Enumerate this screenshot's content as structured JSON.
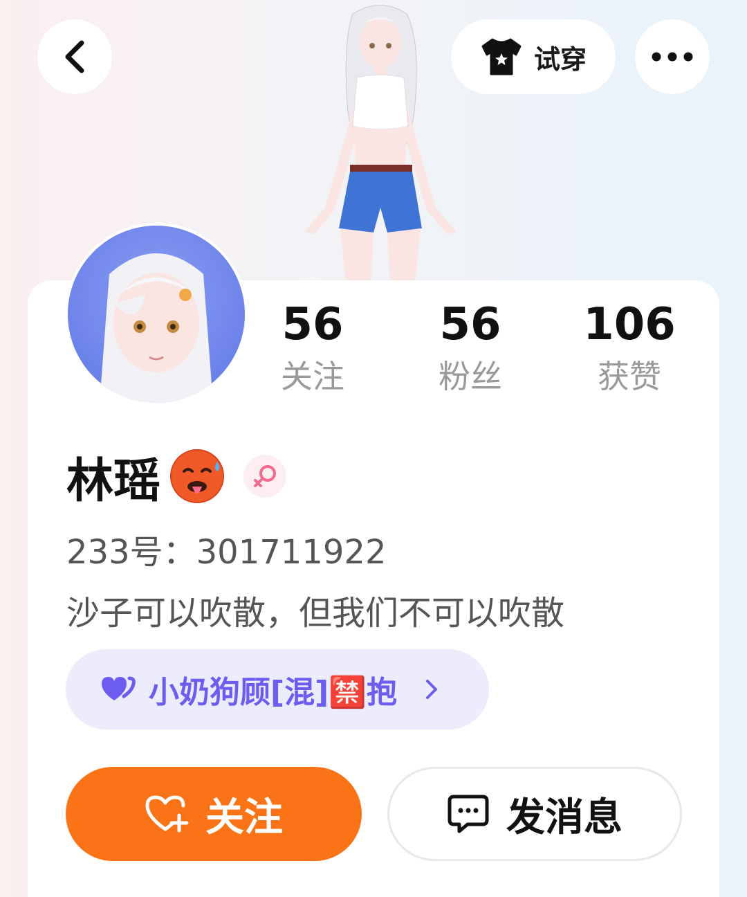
{
  "header": {
    "back_icon": "chevron-left-icon",
    "tryon_label": "试穿",
    "tryon_icon": "tshirt-icon",
    "more_icon": "more-dots-icon"
  },
  "profile": {
    "name": "林瑶",
    "name_emoji": "🥵",
    "gender": "female",
    "id_label": "233号：",
    "id_value": "301711922",
    "bio": "沙子可以吹散，但我们不可以吹散"
  },
  "stats": [
    {
      "value": "56",
      "label": "关注"
    },
    {
      "value": "56",
      "label": "粉丝"
    },
    {
      "value": "106",
      "label": "获赞"
    }
  ],
  "tag": {
    "text": "小奶狗顾[混]🈲抱",
    "icon": "double-heart-icon"
  },
  "actions": {
    "follow_label": "关注",
    "message_label": "发消息"
  },
  "colors": {
    "accent_orange": "#fb7317",
    "tag_purple": "#6c5cf0",
    "tag_bg": "#ececfd",
    "avatar_bg": "#6b82ea"
  }
}
